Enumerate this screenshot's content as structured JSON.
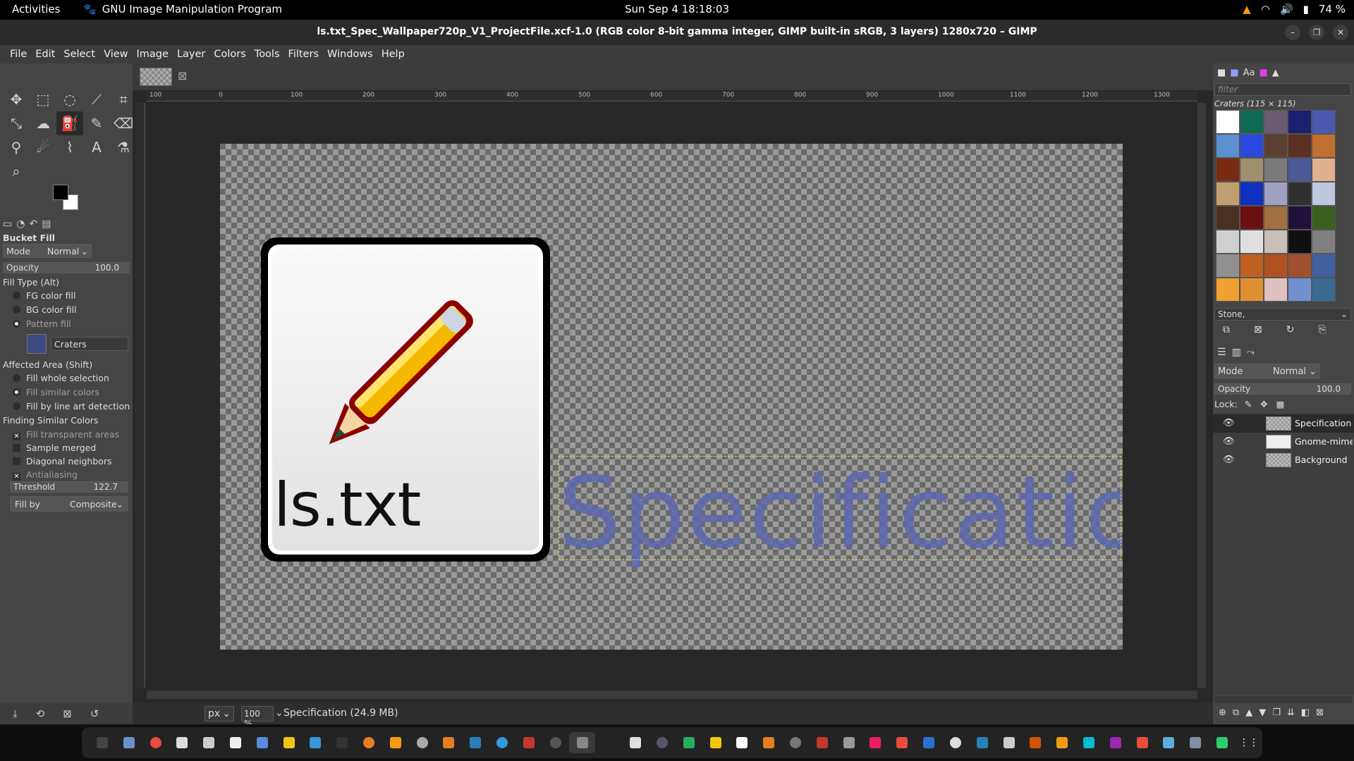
{
  "topbar": {
    "activities": "Activities",
    "app_name": "GNU Image Manipulation Program",
    "clock": "Sun Sep 4  18:18:03",
    "battery": "74 %"
  },
  "window": {
    "title": "ls.txt_Spec_Wallpaper720p_V1_ProjectFile.xcf-1.0 (RGB color 8-bit gamma integer, GIMP built-in sRGB, 3 layers) 1280x720 – GIMP"
  },
  "menu": [
    "File",
    "Edit",
    "Select",
    "View",
    "Image",
    "Layer",
    "Colors",
    "Tools",
    "Filters",
    "Windows",
    "Help"
  ],
  "tool_options": {
    "title": "Bucket Fill",
    "mode_label": "Mode",
    "mode_value": "Normal",
    "opacity_label": "Opacity",
    "opacity_value": "100.0",
    "fill_type_label": "Fill Type  (Alt)",
    "fill_types": [
      "FG color fill",
      "BG color fill",
      "Pattern fill"
    ],
    "pattern_name": "Craters",
    "affected_label": "Affected Area  (Shift)",
    "affected": [
      "Fill whole selection",
      "Fill similar colors",
      "Fill by line art detection"
    ],
    "finding_label": "Finding Similar Colors",
    "options": [
      "Fill transparent areas",
      "Sample merged",
      "Diagonal neighbors",
      "Antialiasing"
    ],
    "threshold_label": "Threshold",
    "threshold_value": "122.7",
    "fillby_label": "Fill by",
    "fillby_value": "Composite"
  },
  "canvas": {
    "icon_text": "ls.txt",
    "spec_text": "Specification",
    "ruler_marks": [
      "100",
      "0",
      "100",
      "200",
      "300",
      "400",
      "500",
      "600",
      "700",
      "800",
      "900",
      "1000",
      "1100",
      "1200",
      "1300"
    ]
  },
  "statusbar": {
    "unit": "px",
    "zoom": "100 %",
    "info": "Specification (24.9 MB)"
  },
  "dock": {
    "filter_placeholder": "filter",
    "pattern_title": "Craters (115 × 115)",
    "pattern_tag": "Stone,",
    "mode_label": "Mode",
    "mode_value": "Normal",
    "opacity_label": "Opacity",
    "opacity_value": "100.0",
    "lock_label": "Lock:",
    "layers": [
      "Specification",
      "Gnome-mime-",
      "Background"
    ]
  },
  "colors": {
    "accent": "#5b68b0",
    "selection": "#d8d860"
  }
}
